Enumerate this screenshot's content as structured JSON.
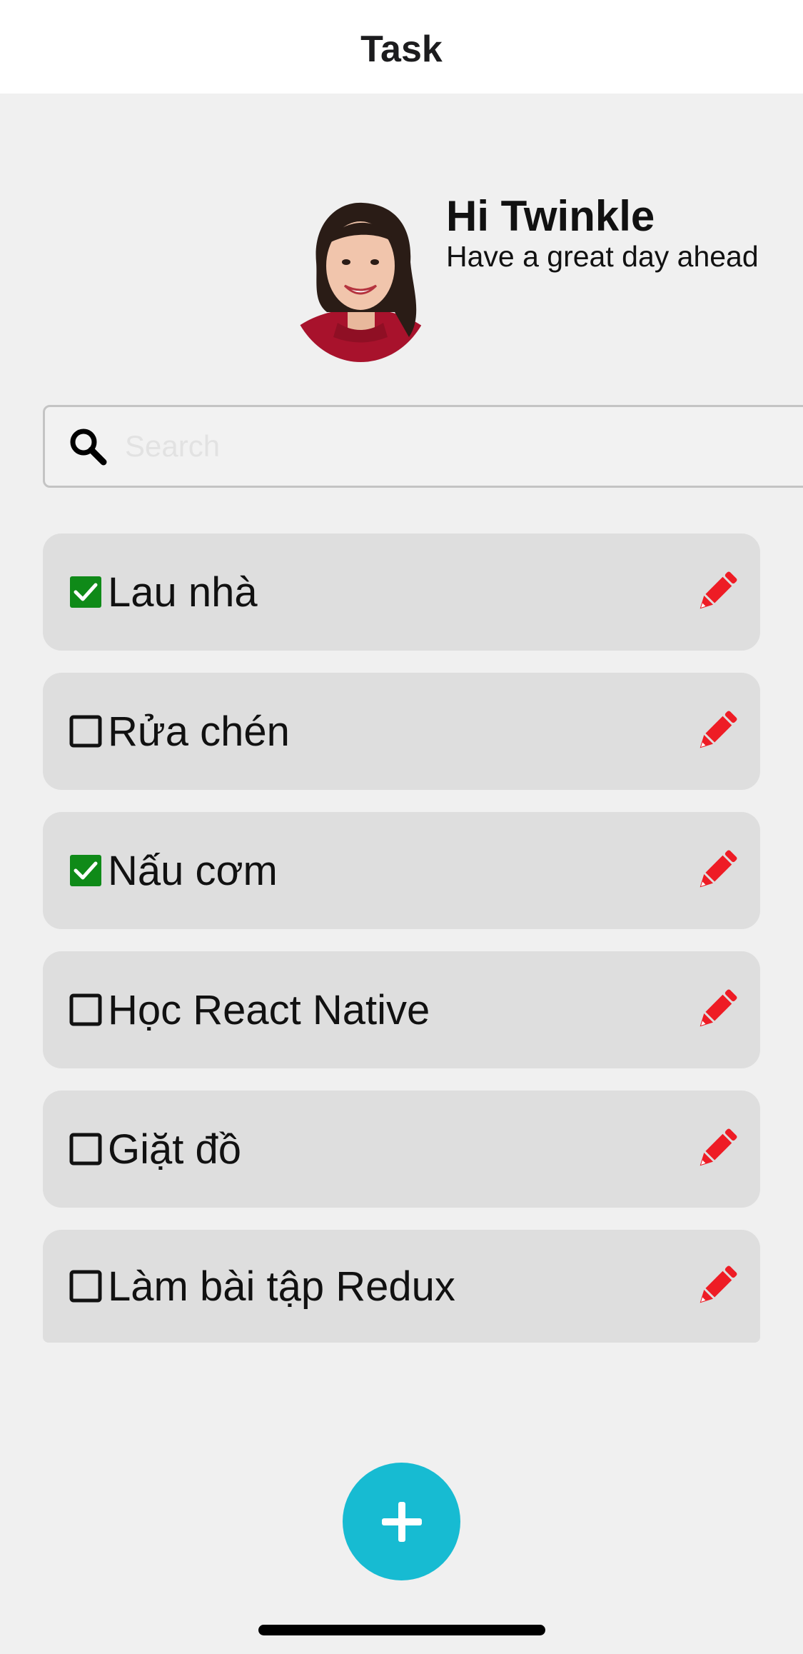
{
  "header": {
    "title": "Task"
  },
  "greeting": {
    "title": "Hi Twinkle",
    "subtitle": "Have a great day ahead"
  },
  "search": {
    "placeholder": "Search",
    "value": ""
  },
  "tasks": [
    {
      "label": "Lau nhà",
      "checked": true
    },
    {
      "label": "Rửa chén",
      "checked": false
    },
    {
      "label": "Nấu cơm",
      "checked": true
    },
    {
      "label": "Học React Native",
      "checked": false
    },
    {
      "label": "Giặt đồ",
      "checked": false
    },
    {
      "label": "Làm bài tập Redux",
      "checked": false
    }
  ],
  "icons": {
    "search": "search-icon",
    "edit": "pencil-icon",
    "checked": "checkbox-checked-icon",
    "unchecked": "checkbox-unchecked-icon",
    "add": "plus-icon"
  },
  "colors": {
    "accent": "#17bbd2",
    "edit": "#ee1c25",
    "checked": "#0f8a18",
    "card": "#dedede",
    "background": "#f0f0f0"
  }
}
